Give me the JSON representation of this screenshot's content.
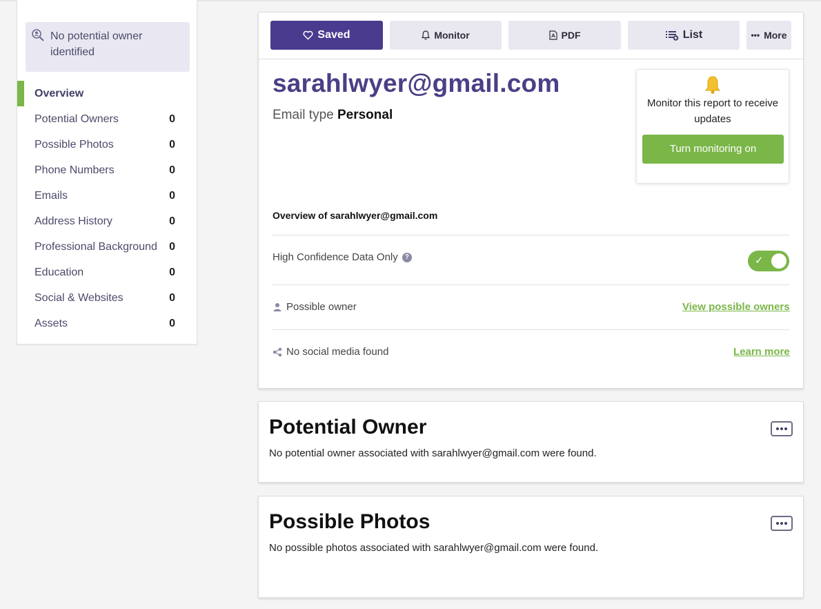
{
  "sidebar": {
    "owner_notice": "No potential owner identified",
    "items": [
      {
        "label": "Overview",
        "count": ""
      },
      {
        "label": "Potential Owners",
        "count": "0"
      },
      {
        "label": "Possible Photos",
        "count": "0"
      },
      {
        "label": "Phone Numbers",
        "count": "0"
      },
      {
        "label": "Emails",
        "count": "0"
      },
      {
        "label": "Address History",
        "count": "0"
      },
      {
        "label": "Professional Background",
        "count": "0"
      },
      {
        "label": "Education",
        "count": "0"
      },
      {
        "label": "Social & Websites",
        "count": "0"
      },
      {
        "label": "Assets",
        "count": "0"
      }
    ]
  },
  "toolbar": {
    "saved_label": "Saved",
    "monitor_label": "Monitor",
    "pdf_label": "PDF",
    "list_label": "List",
    "more_label": "More"
  },
  "report": {
    "email": "sarahlwyer@gmail.com",
    "email_type_label": "Email type",
    "email_type_value": "Personal",
    "overview_heading": "Overview of sarahlwyer@gmail.com",
    "high_confidence_label": "High Confidence Data Only",
    "high_confidence_on": true,
    "possible_owner_label": "Possible owner",
    "view_owners_link": "View possible owners",
    "social_label": "No social media found",
    "learn_more_link": "Learn more"
  },
  "monitor": {
    "text": "Monitor this report to receive updates",
    "button_label": "Turn monitoring on"
  },
  "sections": {
    "potential_owner": {
      "title": "Potential Owner",
      "text": "No potential owner associated with sarahlwyer@gmail.com were found."
    },
    "possible_photos": {
      "title": "Possible Photos",
      "text": "No possible photos associated with sarahlwyer@gmail.com were found."
    }
  },
  "colors": {
    "brand_purple": "#4b3b8f",
    "accent_green": "#7ab648"
  }
}
